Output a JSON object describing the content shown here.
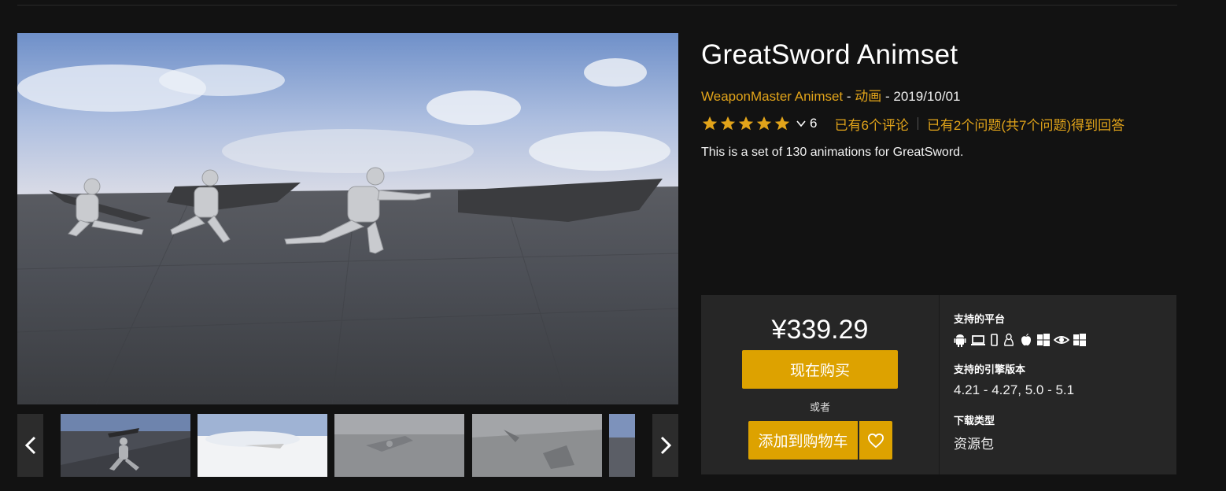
{
  "product": {
    "title": "GreatSword Animset",
    "seller": "WeaponMaster Animset",
    "separator": " - ",
    "category": "动画",
    "date": "2019/10/01",
    "rating_count": "6",
    "reviews_link": "已有6个评论",
    "questions_link": "已有2个问题(共7个问题)得到回答",
    "description": "This is a set of 130 animations for GreatSword."
  },
  "purchase": {
    "price": "¥339.29",
    "buy_now": "现在购买",
    "or": "或者",
    "add_to_cart": "添加到购物车"
  },
  "info": {
    "platforms_label": "支持的平台",
    "platforms": [
      "android-icon",
      "desktop-icon",
      "mobile-icon",
      "linux-icon",
      "apple-icon",
      "windows-icon",
      "vr-eye-icon",
      "windows-store-icon"
    ],
    "engine_label": "支持的引擎版本",
    "engine_versions": "4.21 - 4.27, 5.0 - 5.1",
    "download_label": "下载类型",
    "download_type": "资源包"
  },
  "colors": {
    "accent": "#dda200",
    "link": "#e2a41a",
    "background": "#121212",
    "panel": "#262626"
  }
}
